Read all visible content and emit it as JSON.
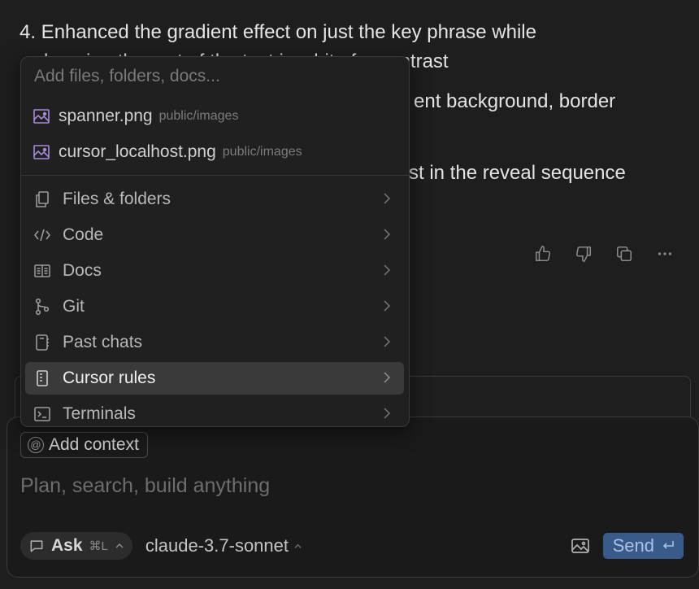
{
  "chat": {
    "line1": "4. Enhanced the gradient effect on just the key phrase while",
    "line2": "keeping the rest of the text in white for contrast",
    "line3_tail": "ent background, border",
    "line4_tail": "st in the reveal sequence"
  },
  "popup": {
    "search_placeholder": "Add files, folders, docs...",
    "files": [
      {
        "name": "spanner.png",
        "path": "public/images",
        "icon": "image-file-icon"
      },
      {
        "name": "cursor_localhost.png",
        "path": "public/images",
        "icon": "image-file-icon"
      }
    ],
    "menu": [
      {
        "label": "Files & folders",
        "icon": "files-icon"
      },
      {
        "label": "Code",
        "icon": "code-icon"
      },
      {
        "label": "Docs",
        "icon": "docs-book-icon"
      },
      {
        "label": "Git",
        "icon": "git-branch-icon"
      },
      {
        "label": "Past chats",
        "icon": "past-chats-icon"
      },
      {
        "label": "Cursor rules",
        "icon": "rules-icon",
        "active": true
      },
      {
        "label": "Terminals",
        "icon": "terminal-icon"
      }
    ]
  },
  "composer": {
    "add_context_label": "Add context",
    "prompt_placeholder": "Plan, search, build anything",
    "mode_label": "Ask",
    "mode_shortcut": "⌘L",
    "model_name": "claude-3.7-sonnet",
    "send_label": "Send"
  },
  "colors": {
    "background": "#1e1e1e",
    "popup_bg": "#202020",
    "active_item": "#3a3a3a",
    "send_bg": "#3a5a8a",
    "image_icon_accent": "#a78bdb"
  }
}
